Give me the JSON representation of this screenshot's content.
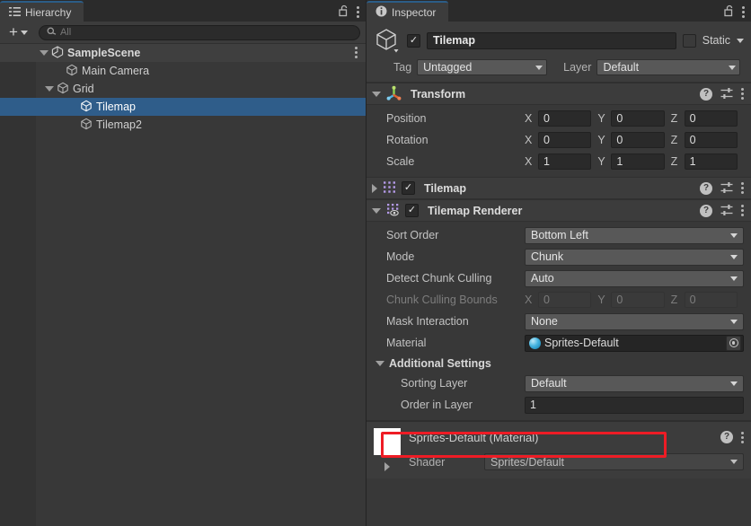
{
  "hierarchy": {
    "tab_label": "Hierarchy",
    "tab_icon": "hierarchy-list-icon",
    "lock_icon": "padlock-open-icon",
    "menu_icon": "kebab-menu-icon",
    "toolbar": {
      "add_label": "+",
      "add_icon": "plus-icon",
      "dropdown_icon": "chevron-down-icon",
      "search_icon": "search-icon",
      "search_value": "",
      "search_placeholder": "All"
    },
    "rows": [
      {
        "label": "SampleScene",
        "icon": "unity-scene-icon",
        "indent": 1,
        "foldout": "open",
        "selected": false,
        "is_scene": true,
        "kebab": true
      },
      {
        "label": "Main Camera",
        "icon": "gameobject-cube-icon",
        "indent": 2,
        "foldout": "none",
        "selected": false,
        "is_scene": false,
        "kebab": false
      },
      {
        "label": "Grid",
        "icon": "gameobject-cube-icon",
        "indent": 2,
        "foldout": "open",
        "selected": false,
        "is_scene": false,
        "kebab": false
      },
      {
        "label": "Tilemap",
        "icon": "gameobject-cube-icon",
        "indent": 3,
        "foldout": "none",
        "selected": true,
        "is_scene": false,
        "kebab": false
      },
      {
        "label": "Tilemap2",
        "icon": "gameobject-cube-icon",
        "indent": 3,
        "foldout": "none",
        "selected": false,
        "is_scene": false,
        "kebab": false
      }
    ]
  },
  "inspector": {
    "tab_label": "Inspector",
    "tab_icon": "info-circle-icon",
    "lock_icon": "padlock-open-icon",
    "menu_icon": "kebab-menu-icon",
    "object_header": {
      "prefab_icon": "gameobject-cube-icon",
      "enabled": true,
      "enabled_check": "✓",
      "name_value": "Tilemap",
      "static_checked": false,
      "static_label": "Static",
      "static_dropdown_icon": "chevron-down-icon",
      "tag_label": "Tag",
      "tag_value": "Untagged",
      "layer_label": "Layer",
      "layer_value": "Default"
    },
    "components": [
      {
        "name": "Transform",
        "icon": "transform-gizmo-icon",
        "foldout": "open",
        "has_checkbox": false,
        "help_icon": "help-circle-icon",
        "preset_icon": "preset-sliders-icon",
        "menu_icon": "kebab-menu-icon",
        "rows": [
          {
            "type": "vector3",
            "label": "Position",
            "dim": false,
            "axes": [
              "X",
              "Y",
              "Z"
            ],
            "values": [
              "0",
              "0",
              "0"
            ]
          },
          {
            "type": "vector3",
            "label": "Rotation",
            "dim": false,
            "axes": [
              "X",
              "Y",
              "Z"
            ],
            "values": [
              "0",
              "0",
              "0"
            ]
          },
          {
            "type": "vector3",
            "label": "Scale",
            "dim": false,
            "axes": [
              "X",
              "Y",
              "Z"
            ],
            "values": [
              "1",
              "1",
              "1"
            ]
          }
        ]
      },
      {
        "name": "Tilemap",
        "icon": "tilemap-grid-icon",
        "foldout": "closed",
        "has_checkbox": true,
        "enabled": true,
        "enabled_check": "✓",
        "help_icon": "help-circle-icon",
        "preset_icon": "preset-sliders-icon",
        "menu_icon": "kebab-menu-icon",
        "rows": []
      },
      {
        "name": "Tilemap Renderer",
        "icon": "tilemap-renderer-icon",
        "foldout": "open",
        "has_checkbox": true,
        "enabled": true,
        "enabled_check": "✓",
        "help_icon": "help-circle-icon",
        "preset_icon": "preset-sliders-icon",
        "menu_icon": "kebab-menu-icon",
        "rows": [
          {
            "type": "popup",
            "label": "Sort Order",
            "value": "Bottom Left",
            "dim": false
          },
          {
            "type": "popup",
            "label": "Mode",
            "value": "Chunk",
            "dim": false
          },
          {
            "type": "popup",
            "label": "Detect Chunk Culling",
            "value": "Auto",
            "dim": false
          },
          {
            "type": "vector3",
            "label": "Chunk Culling Bounds",
            "dim": true,
            "axes": [
              "X",
              "Y",
              "Z"
            ],
            "values": [
              "0",
              "0",
              "0"
            ]
          },
          {
            "type": "popup",
            "label": "Mask Interaction",
            "value": "None",
            "dim": false
          },
          {
            "type": "object",
            "label": "Material",
            "value": "Sprites-Default",
            "icon": "material-sphere-icon",
            "picker_icon": "object-picker-icon",
            "dim": false
          }
        ],
        "section": {
          "title": "Additional Settings",
          "foldout": "open",
          "rows": [
            {
              "type": "popup",
              "label": "Sorting Layer",
              "value": "Default",
              "dim": false,
              "highlighted": false
            },
            {
              "type": "text",
              "label": "Order in Layer",
              "value": "1",
              "dim": false,
              "highlighted": true
            }
          ]
        }
      }
    ],
    "material_preview": {
      "swatch_color": "#ffffff",
      "title": "Sprites-Default (Material)",
      "help_icon": "help-circle-icon",
      "menu_icon": "kebab-menu-icon",
      "foldout_icon": "chevron-right-icon",
      "shader_label": "Shader",
      "shader_value": "Sprites/Default"
    }
  },
  "annotation": {
    "highlight_color": "#ee1c25",
    "target": "Order in Layer"
  }
}
